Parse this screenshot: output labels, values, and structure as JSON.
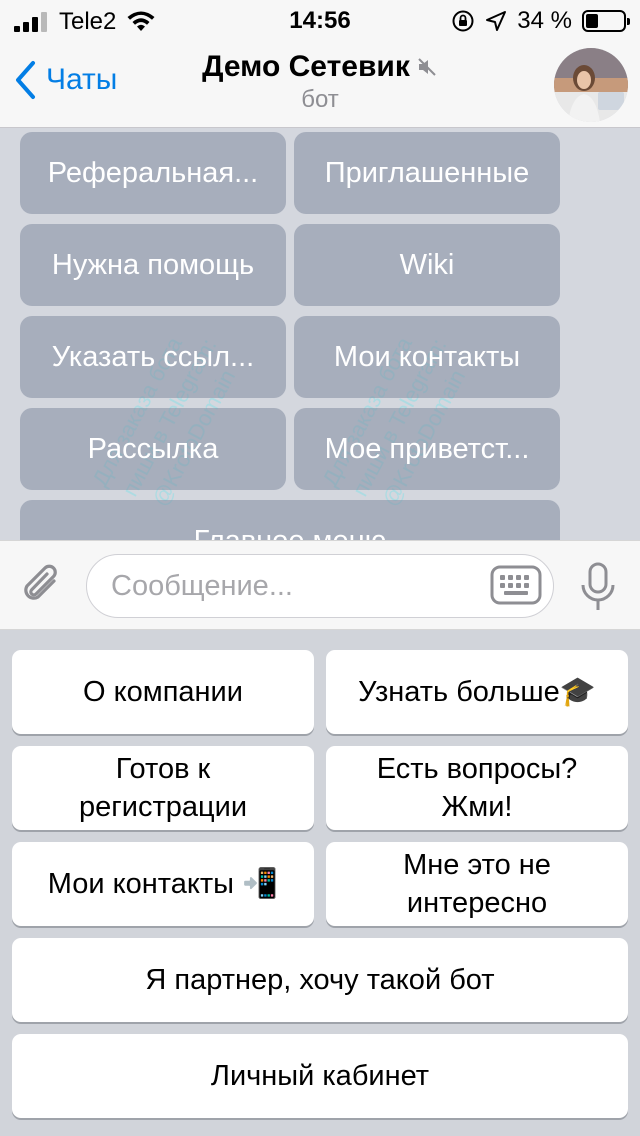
{
  "status_bar": {
    "carrier": "Tele2",
    "time": "14:56",
    "battery_percent": "34 %",
    "battery_level": 0.34
  },
  "nav": {
    "back_label": "Чаты",
    "title": "Демо Сетевик",
    "subtitle": "бот",
    "muted_icon": "speaker-muted-icon"
  },
  "inline_keyboard": [
    "Реферальная...",
    "Приглашенные",
    "Нужна помощь",
    "Wiki",
    "Указать ссыл...",
    "Мои контакты",
    "Рассылка",
    "Мое приветст...",
    "Главное меню"
  ],
  "watermark": {
    "lines": [
      "Для заказа бота",
      "пиши в Telegram:",
      "@KrotoDomain"
    ]
  },
  "composer": {
    "placeholder": "Сообщение...",
    "attach_icon": "paperclip-icon",
    "keyboard_icon": "keyboard-icon",
    "mic_icon": "microphone-icon"
  },
  "reply_keyboard": {
    "about": "О компании",
    "learn_more": "Узнать больше🎓",
    "ready_register_1": "Готов к",
    "ready_register_2": "регистрации",
    "questions_1": "Есть вопросы?",
    "questions_2": "Жми!",
    "my_contacts": "Мои контакты 📲",
    "not_interested_1": "Мне это не",
    "not_interested_2": "интересно",
    "partner": "Я партнер, хочу такой бот",
    "cabinet": "Личный кабинет"
  }
}
